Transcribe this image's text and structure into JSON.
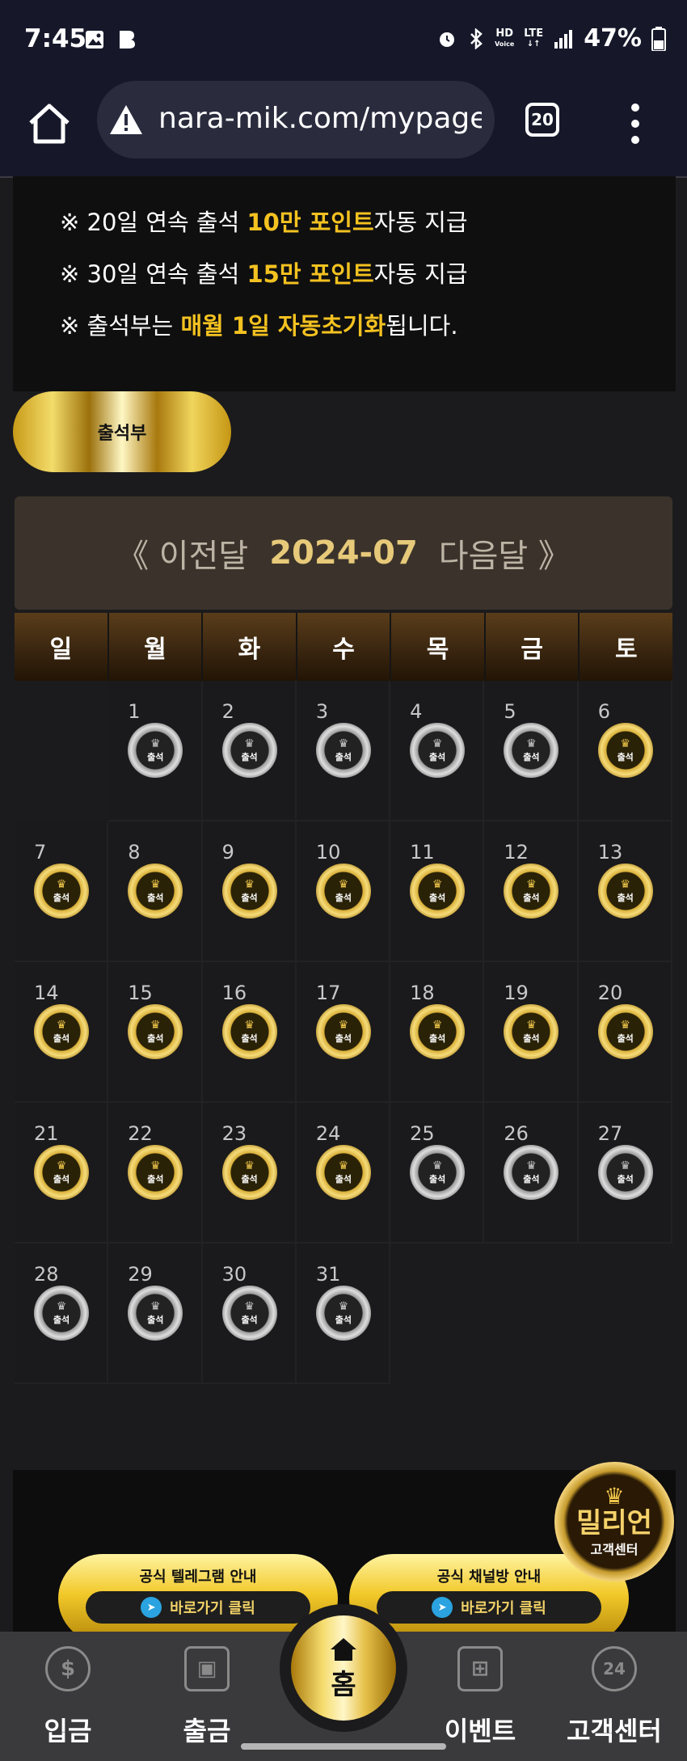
{
  "status_bar": {
    "time": "7:45",
    "hd_label": "HD",
    "voice_label": "Voice",
    "lte_label": "LTE",
    "battery": "47%"
  },
  "browser": {
    "url": "nara-mik.com/mypage",
    "tab_count": "20"
  },
  "notice": {
    "lines": [
      {
        "pre": "※ 20일 연속 출석 ",
        "highlight": "10만 포인트",
        "post": "자동 지급"
      },
      {
        "pre": "※ 30일 연속 출석 ",
        "highlight": "15만 포인트",
        "post": "자동 지급"
      },
      {
        "pre": "※ 출석부는 ",
        "highlight": "매월 1일 자동초기화",
        "post": "됩니다."
      }
    ]
  },
  "attendance_button": "출석부",
  "month_nav": {
    "prev": "《 이전달",
    "current": "2024-07",
    "next": "다음달 》"
  },
  "weekdays": [
    "일",
    "월",
    "화",
    "수",
    "목",
    "금",
    "토"
  ],
  "stamp_label": "출석",
  "calendar": {
    "weeks": [
      [
        null,
        {
          "day": "1",
          "checked": false
        },
        {
          "day": "2",
          "checked": false
        },
        {
          "day": "3",
          "checked": false
        },
        {
          "day": "4",
          "checked": false
        },
        {
          "day": "5",
          "checked": false
        },
        {
          "day": "6",
          "checked": true
        }
      ],
      [
        {
          "day": "7",
          "checked": true
        },
        {
          "day": "8",
          "checked": true
        },
        {
          "day": "9",
          "checked": true
        },
        {
          "day": "10",
          "checked": true
        },
        {
          "day": "11",
          "checked": true
        },
        {
          "day": "12",
          "checked": true
        },
        {
          "day": "13",
          "checked": true
        }
      ],
      [
        {
          "day": "14",
          "checked": true
        },
        {
          "day": "15",
          "checked": true
        },
        {
          "day": "16",
          "checked": true
        },
        {
          "day": "17",
          "checked": true
        },
        {
          "day": "18",
          "checked": true
        },
        {
          "day": "19",
          "checked": true
        },
        {
          "day": "20",
          "checked": true
        }
      ],
      [
        {
          "day": "21",
          "checked": true
        },
        {
          "day": "22",
          "checked": true
        },
        {
          "day": "23",
          "checked": true
        },
        {
          "day": "24",
          "checked": true
        },
        {
          "day": "25",
          "checked": false
        },
        {
          "day": "26",
          "checked": false
        },
        {
          "day": "27",
          "checked": false
        }
      ],
      [
        {
          "day": "28",
          "checked": false
        },
        {
          "day": "29",
          "checked": false
        },
        {
          "day": "30",
          "checked": false
        },
        {
          "day": "31",
          "checked": false
        },
        null,
        null,
        null
      ]
    ]
  },
  "banner": {
    "telegram_title": "공식 텔레그램 안내",
    "channel_title": "공식 채널방 안내",
    "go_label": "바로가기 클릭"
  },
  "cs_badge": {
    "big": "밀리언",
    "small": "고객센터"
  },
  "bottom_nav": {
    "deposit": "입금",
    "withdraw": "출금",
    "home": "홈",
    "event": "이벤트",
    "support": "고객센터"
  },
  "colors": {
    "gold": "#f4c220",
    "background": "#1b1b1d"
  }
}
